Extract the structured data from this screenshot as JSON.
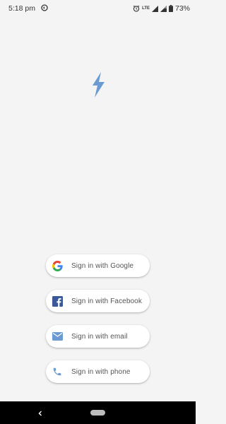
{
  "status_bar": {
    "time": "5:18 pm",
    "network_label": "LTE",
    "battery_percent": "73%"
  },
  "app": {
    "logo_icon": "lightning-bolt-icon",
    "accent_color": "#6b9bd2"
  },
  "sign_in": {
    "buttons": [
      {
        "label": "Sign in with Google",
        "icon": "google-icon"
      },
      {
        "label": "Sign in with Facebook",
        "icon": "facebook-icon"
      },
      {
        "label": "Sign in with email",
        "icon": "email-icon"
      },
      {
        "label": "Sign in with phone",
        "icon": "phone-icon"
      }
    ]
  }
}
